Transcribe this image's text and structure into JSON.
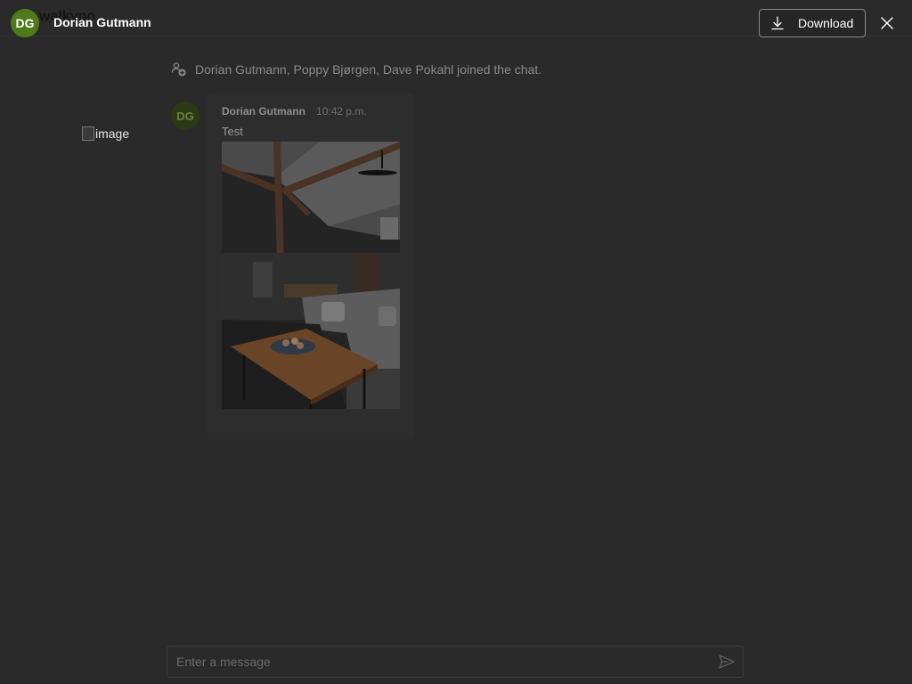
{
  "header": {
    "avatar_initials": "DG",
    "name": "Dorian Gutmann",
    "download_label": "Download",
    "download_icon": "download-icon",
    "close_icon": "close-icon",
    "avatar_color": "#4f7a1a"
  },
  "background_chat": {
    "title": "walkyno",
    "broken_image_alt": "image",
    "system_message": "Dorian Gutmann, Poppy Bjørgen, Dave Pokahl joined the chat.",
    "message": {
      "avatar_initials": "DG",
      "author": "Dorian Gutmann",
      "time": "10:42 p.m.",
      "text": "Test"
    },
    "composer": {
      "placeholder": "Enter a message",
      "send_icon": "send-icon"
    }
  }
}
